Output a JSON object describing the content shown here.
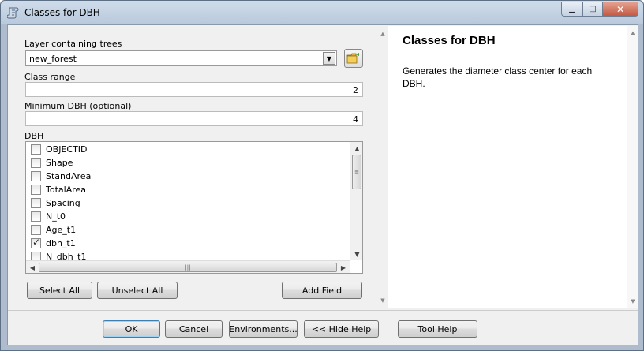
{
  "window": {
    "title": "Classes for DBH",
    "min_glyph": "▁",
    "max_glyph": "□",
    "close_glyph": "✕"
  },
  "form": {
    "layer_label": "Layer containing trees",
    "layer_value": "new_forest",
    "class_range_label": "Class range",
    "class_range_value": "2",
    "min_dbh_label": "Minimum DBH (optional)",
    "min_dbh_value": "4",
    "dbh_label": "DBH",
    "dbh_items": [
      {
        "label": "OBJECTID",
        "checked": false
      },
      {
        "label": "Shape",
        "checked": false
      },
      {
        "label": "StandArea",
        "checked": false
      },
      {
        "label": "TotalArea",
        "checked": false
      },
      {
        "label": "Spacing",
        "checked": false
      },
      {
        "label": "N_t0",
        "checked": false
      },
      {
        "label": "Age_t1",
        "checked": false
      },
      {
        "label": "dbh_t1",
        "checked": true
      },
      {
        "label": "N_dbh_t1",
        "checked": false
      }
    ],
    "select_all": "Select All",
    "unselect_all": "Unselect All",
    "add_field": "Add Field"
  },
  "help": {
    "title": "Classes for DBH",
    "text": "Generates the diameter class center for each DBH."
  },
  "footer": {
    "ok": "OK",
    "cancel": "Cancel",
    "environments": "Environments...",
    "hide_help": "<< Hide Help",
    "tool_help": "Tool Help"
  },
  "icons": {
    "app": "toolbox-script-icon",
    "browse": "open-folder-icon"
  }
}
